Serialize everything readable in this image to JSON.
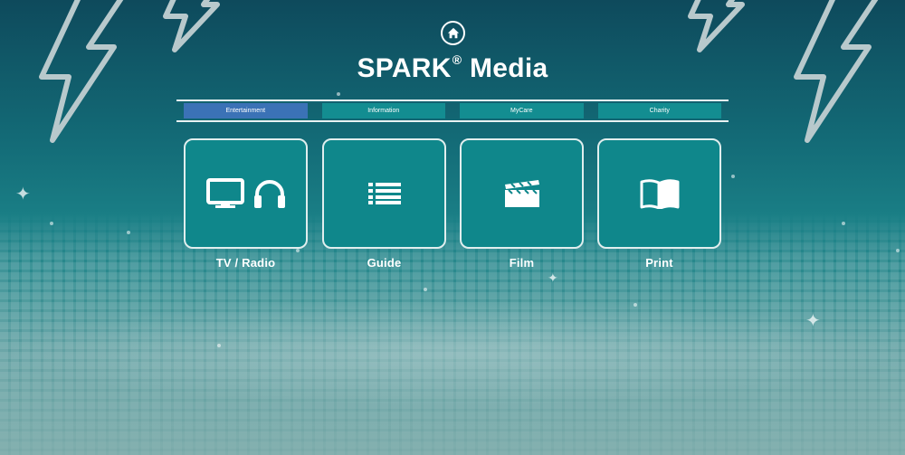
{
  "app": {
    "title": "SPARK",
    "title_mark": "®",
    "title_suffix": "Media"
  },
  "nav": {
    "home_icon": "home-icon",
    "tabs": [
      {
        "label": "Entertainment",
        "active": true
      },
      {
        "label": "Information",
        "active": false
      },
      {
        "label": "MyCare",
        "active": false
      },
      {
        "label": "Charity",
        "active": false
      }
    ]
  },
  "tiles": [
    {
      "label": "TV / Radio",
      "icons": [
        "monitor-icon",
        "headphones-icon"
      ]
    },
    {
      "label": "Guide",
      "icons": [
        "list-icon"
      ]
    },
    {
      "label": "Film",
      "icons": [
        "clapperboard-icon"
      ]
    },
    {
      "label": "Print",
      "icons": [
        "book-icon"
      ]
    }
  ],
  "colors": {
    "tile_fill": "#0f878b",
    "tab_fill": "#138d91",
    "tab_active": "#3b72b6",
    "background_top": "#0e4a5c",
    "background_bottom": "#7aaaa9"
  }
}
